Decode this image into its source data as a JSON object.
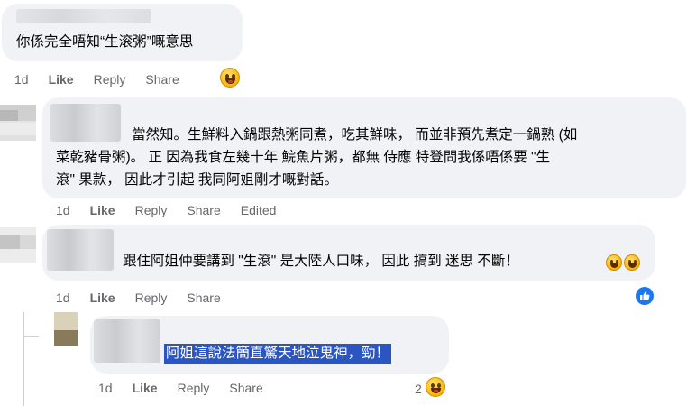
{
  "comments": [
    {
      "text_lines": [
        "你係完全唔知“生滚粥”嘅意思"
      ],
      "actions": {
        "time": "1d",
        "like": "Like",
        "reply": "Reply",
        "share": "Share"
      },
      "reaction_icon": "laughing-emoji"
    },
    {
      "text_lines": [
        "當然知。生鮮料入鍋跟熱粥同煮，吃其鮮味， 而並非預先煮定一鍋熟 (如",
        "菜乾豬骨粥)。 正 因為我食左幾十年 鯇魚片粥，都無 侍應 特登問我係唔係要 \"生",
        "滾\" 果款， 因此才引起 我同阿姐剛才嘅對話。"
      ],
      "actions": {
        "time": "1d",
        "like": "Like",
        "reply": "Reply",
        "share": "Share",
        "edited": "Edited"
      }
    },
    {
      "text_lines": [
        "跟住阿姐仲要講到 \"生滾\" 是大陸人口味， 因此 搞到 迷思 不斷！"
      ],
      "actions": {
        "time": "1d",
        "like": "Like",
        "reply": "Reply",
        "share": "Share"
      },
      "reaction_icon": "like-thumb-icon"
    },
    {
      "text_lines": [
        "阿姐這說法簡直驚天地泣鬼神，勁！"
      ],
      "actions": {
        "time": "1d",
        "like": "Like",
        "reply": "Reply",
        "share": "Share"
      },
      "reaction_count": "2",
      "reaction_icon": "laughing-emoji"
    }
  ],
  "colors": {
    "bubble": "#f0f2f5",
    "meta": "#65676b",
    "highlight": "#2b55c0",
    "like_blue": "#1877f2"
  }
}
